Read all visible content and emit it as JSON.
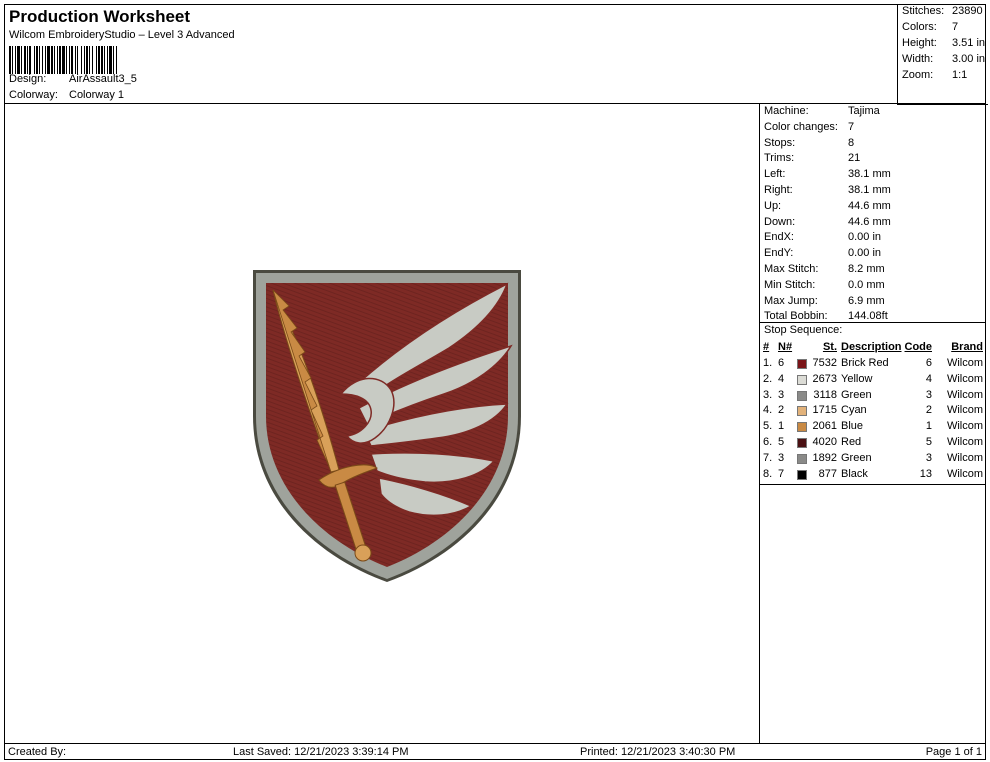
{
  "header": {
    "title": "Production Worksheet",
    "subtitle": "Wilcom EmbroideryStudio – Level 3 Advanced",
    "design_label": "Design:",
    "design_value": "AirAssault3_5",
    "colorway_label": "Colorway:",
    "colorway_value": "Colorway 1"
  },
  "stats": {
    "stitches_label": "Stitches:",
    "stitches_value": "23890",
    "colors_label": "Colors:",
    "colors_value": "7",
    "height_label": "Height:",
    "height_value": "3.51 in",
    "width_label": "Width:",
    "width_value": "3.00 in",
    "zoom_label": "Zoom:",
    "zoom_value": "1:1"
  },
  "info": [
    {
      "label": "Machine:",
      "value": "Tajima"
    },
    {
      "label": "Color changes:",
      "value": "7"
    },
    {
      "label": "Stops:",
      "value": "8"
    },
    {
      "label": "Trims:",
      "value": "21"
    },
    {
      "label": "Left:",
      "value": "38.1 mm"
    },
    {
      "label": "Right:",
      "value": "38.1 mm"
    },
    {
      "label": "Up:",
      "value": "44.6 mm"
    },
    {
      "label": "Down:",
      "value": "44.6 mm"
    },
    {
      "label": "EndX:",
      "value": "0.00 in"
    },
    {
      "label": "EndY:",
      "value": "0.00 in"
    },
    {
      "label": "Max Stitch:",
      "value": "8.2 mm"
    },
    {
      "label": "Min Stitch:",
      "value": "0.0 mm"
    },
    {
      "label": "Max Jump:",
      "value": "6.9 mm"
    },
    {
      "label": "Total Bobbin:",
      "value": "144.08ft"
    }
  ],
  "stop_sequence": {
    "title": "Stop Sequence:",
    "headers": {
      "num": "#",
      "n": "N#",
      "st": "St.",
      "desc": "Description",
      "code": "Code",
      "brand": "Brand"
    },
    "rows": [
      {
        "num": "1.",
        "n": "6",
        "color": "#7a1418",
        "st": "7532",
        "desc": "Brick Red",
        "code": "6",
        "brand": "Wilcom"
      },
      {
        "num": "2.",
        "n": "4",
        "color": "#dcdcd6",
        "st": "2673",
        "desc": "Yellow",
        "code": "4",
        "brand": "Wilcom"
      },
      {
        "num": "3.",
        "n": "3",
        "color": "#8a8a88",
        "st": "3118",
        "desc": "Green",
        "code": "3",
        "brand": "Wilcom"
      },
      {
        "num": "4.",
        "n": "2",
        "color": "#e2b27a",
        "st": "1715",
        "desc": "Cyan",
        "code": "2",
        "brand": "Wilcom"
      },
      {
        "num": "5.",
        "n": "1",
        "color": "#c98a44",
        "st": "2061",
        "desc": "Blue",
        "code": "1",
        "brand": "Wilcom"
      },
      {
        "num": "6.",
        "n": "5",
        "color": "#4a1012",
        "st": "4020",
        "desc": "Red",
        "code": "5",
        "brand": "Wilcom"
      },
      {
        "num": "7.",
        "n": "3",
        "color": "#8a8a88",
        "st": "1892",
        "desc": "Green",
        "code": "3",
        "brand": "Wilcom"
      },
      {
        "num": "8.",
        "n": "7",
        "color": "#000000",
        "st": "877",
        "desc": "Black",
        "code": "13",
        "brand": "Wilcom"
      }
    ]
  },
  "footer": {
    "created_by": "Created By:",
    "last_saved": "Last Saved: 12/21/2023 3:39:14 PM",
    "printed": "Printed: 12/21/2023 3:40:30 PM",
    "page": "Page 1 of 1"
  },
  "colors": {
    "shield_field": "#7e2a25",
    "shield_border": "#9fa39c",
    "shield_outline": "#4a4a40",
    "wing": "#c8cbc4",
    "sword": "#c98a44"
  }
}
